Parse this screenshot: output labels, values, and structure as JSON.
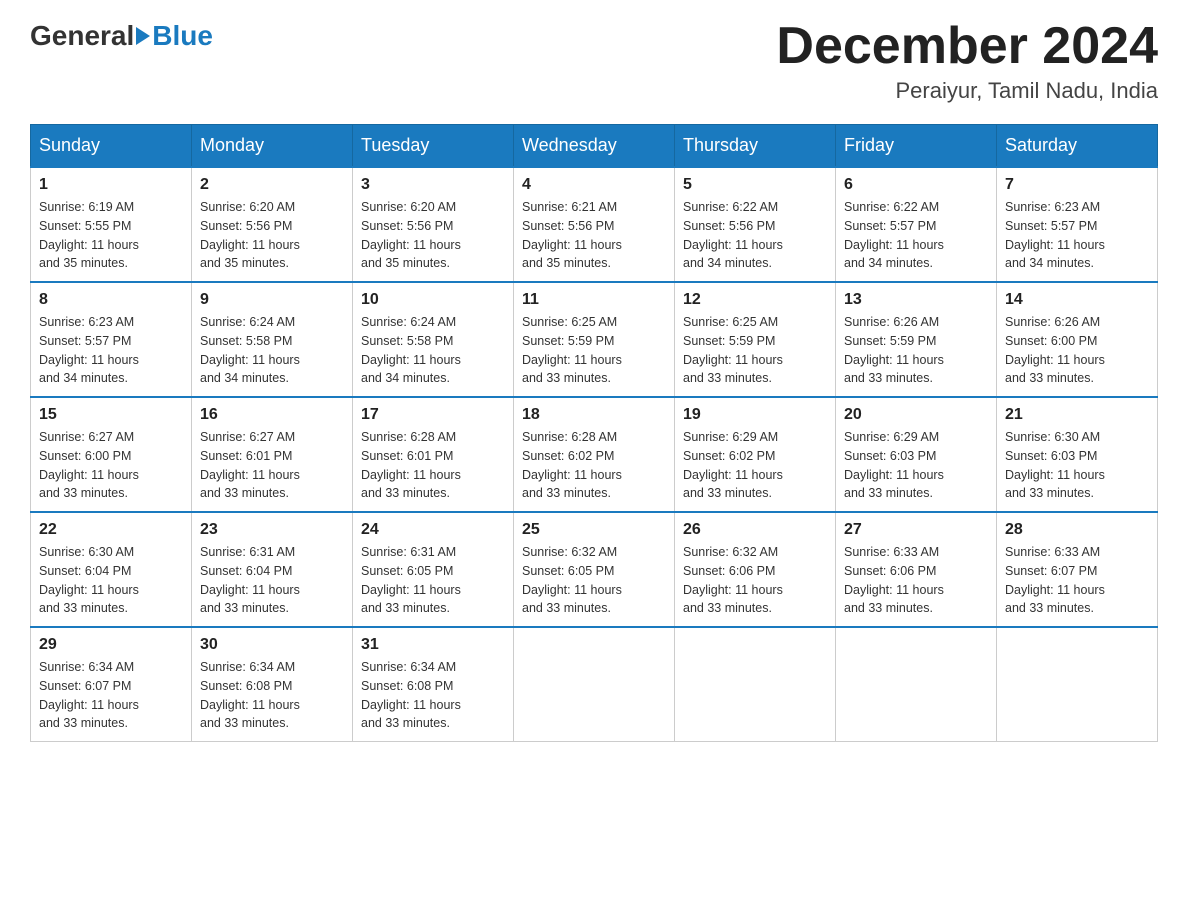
{
  "header": {
    "logo_general": "General",
    "logo_blue": "Blue",
    "month_title": "December 2024",
    "location": "Peraiyur, Tamil Nadu, India"
  },
  "days_of_week": [
    "Sunday",
    "Monday",
    "Tuesday",
    "Wednesday",
    "Thursday",
    "Friday",
    "Saturday"
  ],
  "weeks": [
    [
      {
        "day": "1",
        "sunrise": "6:19 AM",
        "sunset": "5:55 PM",
        "daylight": "11 hours and 35 minutes."
      },
      {
        "day": "2",
        "sunrise": "6:20 AM",
        "sunset": "5:56 PM",
        "daylight": "11 hours and 35 minutes."
      },
      {
        "day": "3",
        "sunrise": "6:20 AM",
        "sunset": "5:56 PM",
        "daylight": "11 hours and 35 minutes."
      },
      {
        "day": "4",
        "sunrise": "6:21 AM",
        "sunset": "5:56 PM",
        "daylight": "11 hours and 35 minutes."
      },
      {
        "day": "5",
        "sunrise": "6:22 AM",
        "sunset": "5:56 PM",
        "daylight": "11 hours and 34 minutes."
      },
      {
        "day": "6",
        "sunrise": "6:22 AM",
        "sunset": "5:57 PM",
        "daylight": "11 hours and 34 minutes."
      },
      {
        "day": "7",
        "sunrise": "6:23 AM",
        "sunset": "5:57 PM",
        "daylight": "11 hours and 34 minutes."
      }
    ],
    [
      {
        "day": "8",
        "sunrise": "6:23 AM",
        "sunset": "5:57 PM",
        "daylight": "11 hours and 34 minutes."
      },
      {
        "day": "9",
        "sunrise": "6:24 AM",
        "sunset": "5:58 PM",
        "daylight": "11 hours and 34 minutes."
      },
      {
        "day": "10",
        "sunrise": "6:24 AM",
        "sunset": "5:58 PM",
        "daylight": "11 hours and 34 minutes."
      },
      {
        "day": "11",
        "sunrise": "6:25 AM",
        "sunset": "5:59 PM",
        "daylight": "11 hours and 33 minutes."
      },
      {
        "day": "12",
        "sunrise": "6:25 AM",
        "sunset": "5:59 PM",
        "daylight": "11 hours and 33 minutes."
      },
      {
        "day": "13",
        "sunrise": "6:26 AM",
        "sunset": "5:59 PM",
        "daylight": "11 hours and 33 minutes."
      },
      {
        "day": "14",
        "sunrise": "6:26 AM",
        "sunset": "6:00 PM",
        "daylight": "11 hours and 33 minutes."
      }
    ],
    [
      {
        "day": "15",
        "sunrise": "6:27 AM",
        "sunset": "6:00 PM",
        "daylight": "11 hours and 33 minutes."
      },
      {
        "day": "16",
        "sunrise": "6:27 AM",
        "sunset": "6:01 PM",
        "daylight": "11 hours and 33 minutes."
      },
      {
        "day": "17",
        "sunrise": "6:28 AM",
        "sunset": "6:01 PM",
        "daylight": "11 hours and 33 minutes."
      },
      {
        "day": "18",
        "sunrise": "6:28 AM",
        "sunset": "6:02 PM",
        "daylight": "11 hours and 33 minutes."
      },
      {
        "day": "19",
        "sunrise": "6:29 AM",
        "sunset": "6:02 PM",
        "daylight": "11 hours and 33 minutes."
      },
      {
        "day": "20",
        "sunrise": "6:29 AM",
        "sunset": "6:03 PM",
        "daylight": "11 hours and 33 minutes."
      },
      {
        "day": "21",
        "sunrise": "6:30 AM",
        "sunset": "6:03 PM",
        "daylight": "11 hours and 33 minutes."
      }
    ],
    [
      {
        "day": "22",
        "sunrise": "6:30 AM",
        "sunset": "6:04 PM",
        "daylight": "11 hours and 33 minutes."
      },
      {
        "day": "23",
        "sunrise": "6:31 AM",
        "sunset": "6:04 PM",
        "daylight": "11 hours and 33 minutes."
      },
      {
        "day": "24",
        "sunrise": "6:31 AM",
        "sunset": "6:05 PM",
        "daylight": "11 hours and 33 minutes."
      },
      {
        "day": "25",
        "sunrise": "6:32 AM",
        "sunset": "6:05 PM",
        "daylight": "11 hours and 33 minutes."
      },
      {
        "day": "26",
        "sunrise": "6:32 AM",
        "sunset": "6:06 PM",
        "daylight": "11 hours and 33 minutes."
      },
      {
        "day": "27",
        "sunrise": "6:33 AM",
        "sunset": "6:06 PM",
        "daylight": "11 hours and 33 minutes."
      },
      {
        "day": "28",
        "sunrise": "6:33 AM",
        "sunset": "6:07 PM",
        "daylight": "11 hours and 33 minutes."
      }
    ],
    [
      {
        "day": "29",
        "sunrise": "6:34 AM",
        "sunset": "6:07 PM",
        "daylight": "11 hours and 33 minutes."
      },
      {
        "day": "30",
        "sunrise": "6:34 AM",
        "sunset": "6:08 PM",
        "daylight": "11 hours and 33 minutes."
      },
      {
        "day": "31",
        "sunrise": "6:34 AM",
        "sunset": "6:08 PM",
        "daylight": "11 hours and 33 minutes."
      },
      null,
      null,
      null,
      null
    ]
  ],
  "labels": {
    "sunrise_prefix": "Sunrise: ",
    "sunset_prefix": "Sunset: ",
    "daylight_prefix": "Daylight: "
  }
}
